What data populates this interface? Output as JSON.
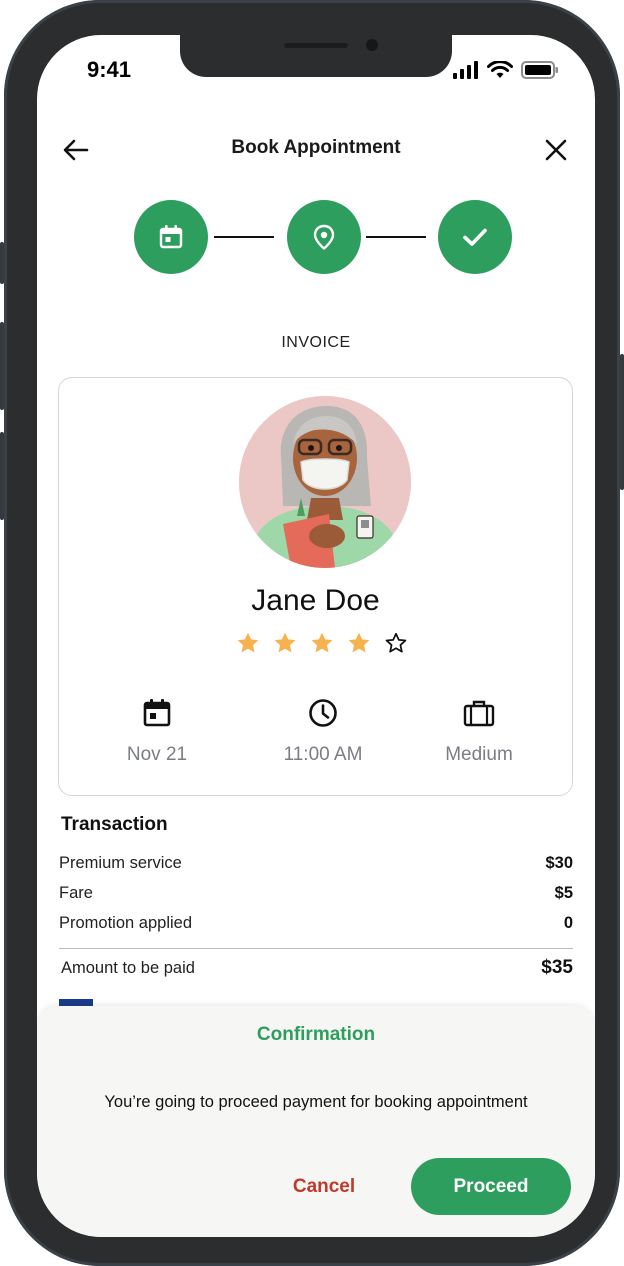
{
  "status_bar": {
    "time": "9:41"
  },
  "header": {
    "title": "Book Appointment",
    "back_icon": "arrow-left-icon",
    "close_icon": "close-icon"
  },
  "stepper": {
    "steps": [
      {
        "icon": "calendar-icon",
        "completed": true
      },
      {
        "icon": "location-pin-icon",
        "completed": true
      },
      {
        "icon": "check-icon",
        "completed": true
      }
    ]
  },
  "invoice": {
    "label": "INVOICE",
    "doctor": {
      "name": "Jane Doe",
      "rating": 4,
      "rating_max": 5
    },
    "details": [
      {
        "icon": "calendar-icon",
        "text": "Nov 21"
      },
      {
        "icon": "clock-icon",
        "text": "11:00 AM"
      },
      {
        "icon": "briefcase-icon",
        "text": "Medium"
      }
    ]
  },
  "transaction": {
    "title": "Transaction",
    "rows": [
      {
        "label": "Premium service",
        "value": "$30"
      },
      {
        "label": "Fare",
        "value": "$5"
      },
      {
        "label": "Promotion applied",
        "value": "0"
      }
    ],
    "total": {
      "label": "Amount to be paid",
      "value": "$35"
    }
  },
  "confirmation": {
    "title": "Confirmation",
    "message": "You’re going to proceed payment for booking appointment",
    "cancel_label": "Cancel",
    "proceed_label": "Proceed"
  },
  "colors": {
    "accent": "#2e9e5e",
    "danger": "#c0392b",
    "star": "#f7b250",
    "muted_text": "#7a7d85"
  }
}
